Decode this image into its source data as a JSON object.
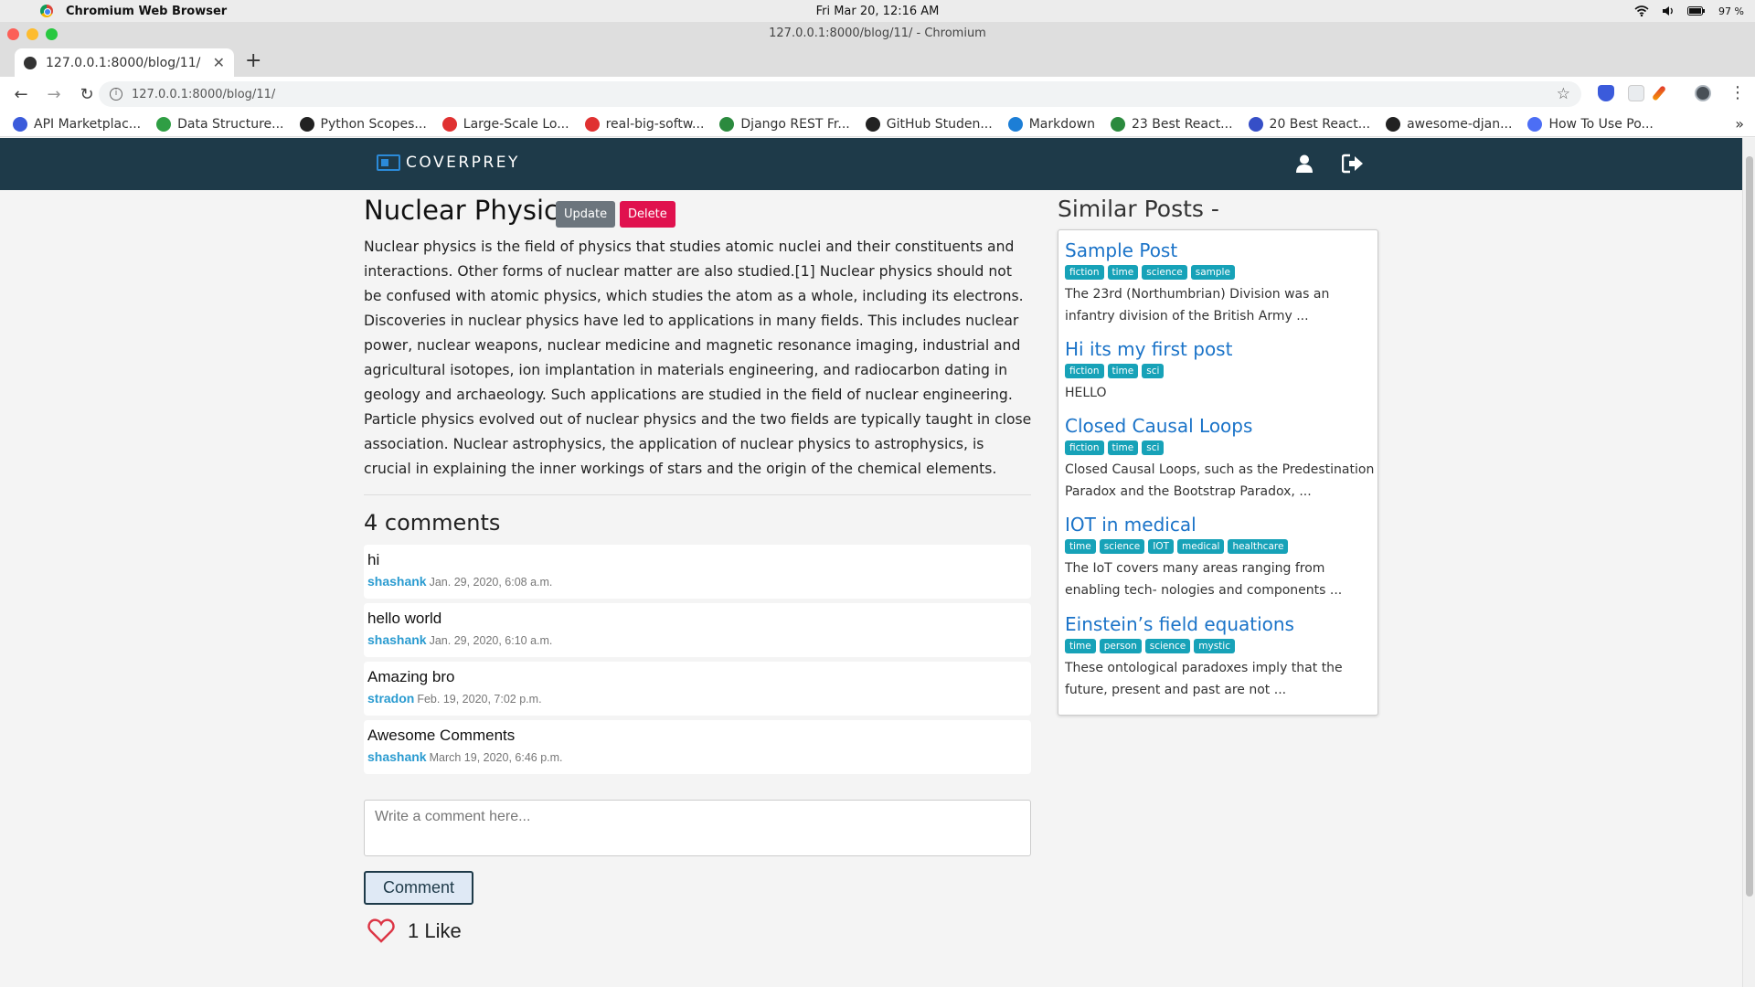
{
  "os": {
    "app_name": "Chromium Web Browser",
    "clock": "Fri Mar 20, 12:16 AM",
    "battery": "97 %"
  },
  "window": {
    "title": "127.0.0.1:8000/blog/11/ - Chromium"
  },
  "tab": {
    "title": "127.0.0.1:8000/blog/11/"
  },
  "address": {
    "url": "127.0.0.1:8000/blog/11/"
  },
  "bookmarks": [
    {
      "label": "API Marketplac...",
      "color": "#3b5bdb"
    },
    {
      "label": "Data Structure...",
      "color": "#2f9e44"
    },
    {
      "label": "Python Scopes...",
      "color": "#222222"
    },
    {
      "label": "Large-Scale Lo...",
      "color": "#e03131"
    },
    {
      "label": "real-big-softw...",
      "color": "#e03131"
    },
    {
      "label": "Django REST Fr...",
      "color": "#2b8a3e"
    },
    {
      "label": "GitHub Studen...",
      "color": "#222222"
    },
    {
      "label": "Markdown",
      "color": "#1c7ed6"
    },
    {
      "label": "23 Best React...",
      "color": "#2b8a3e"
    },
    {
      "label": "20 Best React...",
      "color": "#364fc7"
    },
    {
      "label": "awesome-djan...",
      "color": "#222222"
    },
    {
      "label": "How To Use Po...",
      "color": "#4c6ef5"
    }
  ],
  "site": {
    "brand": "COVERPREY"
  },
  "post": {
    "title": "Nuclear Physics",
    "update_label": "Update",
    "delete_label": "Delete",
    "body": "Nuclear physics is the field of physics that studies atomic nuclei and their constituents and interactions. Other forms of nuclear matter are also studied.[1] Nuclear physics should not be confused with atomic physics, which studies the atom as a whole, including its electrons. Discoveries in nuclear physics have led to applications in many fields. This includes nuclear power, nuclear weapons, nuclear medicine and magnetic resonance imaging, industrial and agricultural isotopes, ion implantation in materials engineering, and radiocarbon dating in geology and archaeology. Such applications are studied in the field of nuclear engineering. Particle physics evolved out of nuclear physics and the two fields are typically taught in close association. Nuclear astrophysics, the application of nuclear physics to astrophysics, is crucial in explaining the inner workings of stars and the origin of the chemical elements."
  },
  "comments": {
    "count_label": "4 comments",
    "items": [
      {
        "text": "hi",
        "author": "shashank",
        "date": "Jan. 29, 2020, 6:08 a.m."
      },
      {
        "text": "hello world",
        "author": "shashank",
        "date": "Jan. 29, 2020, 6:10 a.m."
      },
      {
        "text": "Amazing bro",
        "author": "stradon",
        "date": "Feb. 19, 2020, 7:02 p.m."
      },
      {
        "text": "Awesome Comments",
        "author": "shashank",
        "date": "March 19, 2020, 6:46 p.m."
      }
    ],
    "placeholder": "Write a comment here...",
    "submit_label": "Comment"
  },
  "likes": {
    "label": "1 Like"
  },
  "similar": {
    "heading": "Similar Posts -",
    "posts": [
      {
        "title": "Sample Post",
        "tags": [
          "fiction",
          "time",
          "science",
          "sample"
        ],
        "excerpt": "The 23rd (Northumbrian) Division was an infantry division of the British Army ..."
      },
      {
        "title": "Hi its my first post",
        "tags": [
          "fiction",
          "time",
          "sci"
        ],
        "excerpt": "HELLO"
      },
      {
        "title": "Closed Causal Loops",
        "tags": [
          "fiction",
          "time",
          "sci"
        ],
        "excerpt": "Closed Causal Loops, such as the Predestination Paradox and the Bootstrap Paradox, ..."
      },
      {
        "title": "IOT in medical",
        "tags": [
          "time",
          "science",
          "IOT",
          "medical",
          "healthcare"
        ],
        "excerpt": "The IoT covers many areas ranging from enabling tech- nologies and components ..."
      },
      {
        "title": "Einstein’s field equations",
        "tags": [
          "time",
          "person",
          "science",
          "mystic"
        ],
        "excerpt": "These ontological paradoxes imply that the future, present and past are not ..."
      }
    ]
  }
}
